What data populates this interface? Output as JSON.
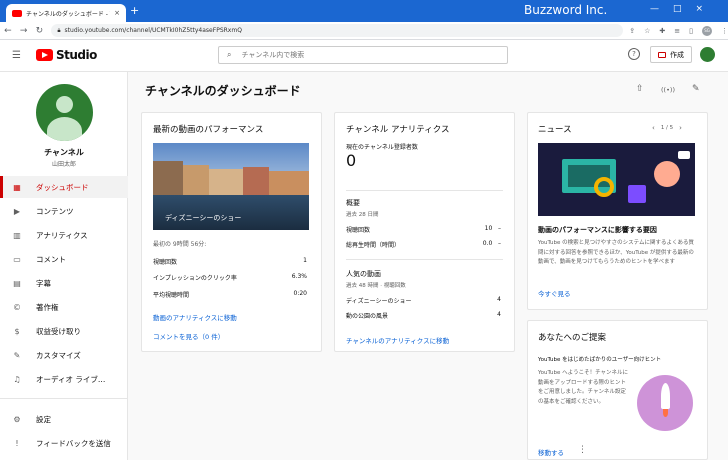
{
  "browser": {
    "tab_title": "チャンネルのダッシュボード - YouTube",
    "tab_close": "×",
    "new_tab": "+",
    "brand": "Buzzword Inc.",
    "url": "studio.youtube.com/channel/UCMTkI0hZ5tty4aseFPSRxmQ",
    "window_controls": [
      "—",
      "□",
      "×"
    ],
    "profile_initials": "SG"
  },
  "header": {
    "logo_text": "Studio",
    "search_placeholder": "チャンネル内で検索",
    "help": "?",
    "create_label": "作成"
  },
  "sidebar": {
    "channel_name": "チャンネル",
    "channel_sub": "山田太郎",
    "items": [
      {
        "label": "ダッシュボード",
        "icon": "dashboard-icon",
        "glyph": "▦",
        "active": true
      },
      {
        "label": "コンテンツ",
        "icon": "content-icon",
        "glyph": "▶"
      },
      {
        "label": "アナリティクス",
        "icon": "analytics-icon",
        "glyph": "▥"
      },
      {
        "label": "コメント",
        "icon": "comment-icon",
        "glyph": "▭"
      },
      {
        "label": "字幕",
        "icon": "subtitles-icon",
        "glyph": "▤"
      },
      {
        "label": "著作権",
        "icon": "copyright-icon",
        "glyph": "©"
      },
      {
        "label": "収益受け取り",
        "icon": "monetization-icon",
        "glyph": "$"
      },
      {
        "label": "カスタマイズ",
        "icon": "customize-icon",
        "glyph": "✎"
      },
      {
        "label": "オーディオ ライブ…",
        "icon": "audio-library-icon",
        "glyph": "♫"
      }
    ],
    "bottom_items": [
      {
        "label": "設定",
        "icon": "settings-icon",
        "glyph": "⚙"
      },
      {
        "label": "フィードバックを送信",
        "icon": "feedback-icon",
        "glyph": "!"
      }
    ]
  },
  "main": {
    "title": "チャンネルのダッシュボード",
    "top_icons": [
      "upload-icon",
      "live-icon",
      "edit-icon"
    ],
    "top_glyphs": [
      "⇧",
      "((•))",
      "✎"
    ],
    "video_perf": {
      "title": "最新の動画のパフォーマンス",
      "thumb_caption": "ディズニーシーのショー",
      "period": "最初の 9時間 56分:",
      "stats": [
        {
          "label": "視聴回数",
          "value": "1"
        },
        {
          "label": "インプレッションのクリック率",
          "value": "6.3%"
        },
        {
          "label": "平均視聴時間",
          "value": "0:20"
        }
      ],
      "link_analytics": "動画のアナリティクスに移動",
      "link_comments": "コメントを見る（0 件）"
    },
    "channel_analytics": {
      "title": "チャンネル アナリティクス",
      "subs_label": "現在のチャンネル登録者数",
      "subs_value": "0",
      "summary_title": "概要",
      "summary_period": "過去 28 日間",
      "summary": [
        {
          "label": "視聴回数",
          "value": "10",
          "delta": "–"
        },
        {
          "label": "総再生時間（時間）",
          "value": "0.0",
          "delta": "–"
        }
      ],
      "top_title": "人気の動画",
      "top_period": "過去 48 時間 · 視聴回数",
      "top": [
        {
          "label": "ディズニーシーのショー",
          "value": "4"
        },
        {
          "label": "動の公園の風景",
          "value": "4"
        }
      ],
      "link": "チャンネルのアナリティクスに移動"
    },
    "news": {
      "title": "ニュース",
      "pager": "1 / 5",
      "prev": "‹",
      "next": "›",
      "headline": "動画のパフォーマンスに影響する要因",
      "body": "YouTube の検索と見つけやすさのシステムに関するよくある質問に対する回答を参照できるほか、YouTube が提供する最新の動画で、動画を見つけてもらうためのヒントを学べます",
      "link": "今すぐ見る"
    },
    "tips": {
      "title": "あなたへのご提案",
      "subtitle": "YouTube をはじめたばかりのユーザー向けヒント",
      "body": "YouTube へようこそ！チャンネルに動画をアップロードする際のヒントをご用意しました。チャンネル設定の基本をご確認ください。",
      "link": "移動する",
      "more": "⋮"
    }
  }
}
